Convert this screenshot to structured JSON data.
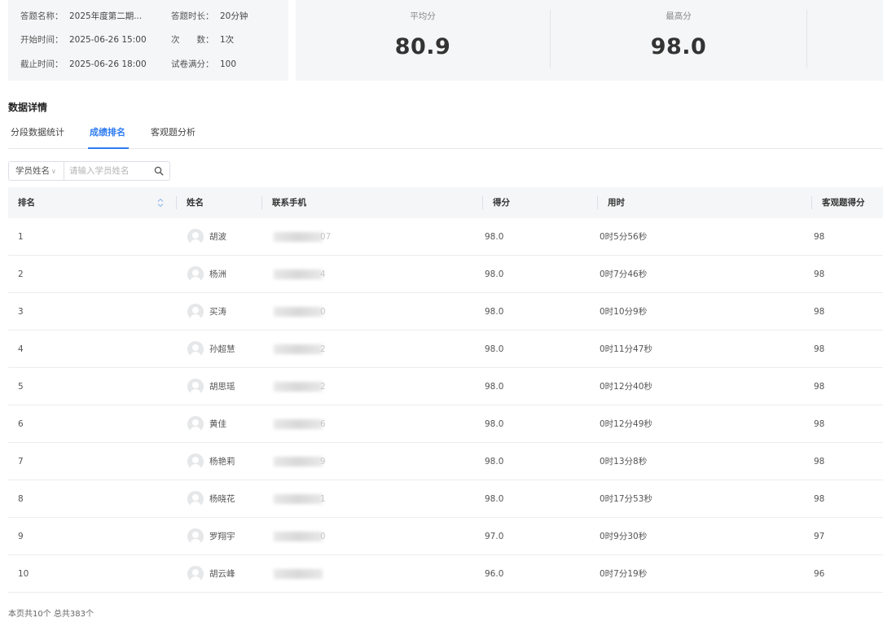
{
  "exam_info": {
    "name_label": "答题名称：",
    "name_value": "2025年度第二期...",
    "duration_label": "答题时长：",
    "duration_value": "20分钟",
    "start_label": "开始时间：",
    "start_value": "2025-06-26 15:00",
    "attempts_label": "次　　数：",
    "attempts_value": "1次",
    "end_label": "截止时间：",
    "end_value": "2025-06-26 18:00",
    "full_score_label": "试卷满分：",
    "full_score_value": "100"
  },
  "stats": {
    "avg_label": "平均分",
    "avg_value": "80.9",
    "max_label": "最高分",
    "max_value": "98.0"
  },
  "section_title": "数据详情",
  "tabs": [
    {
      "label": "分段数据统计",
      "active": false
    },
    {
      "label": "成绩排名",
      "active": true
    },
    {
      "label": "客观题分析",
      "active": false
    }
  ],
  "search": {
    "select_value": "学员姓名",
    "placeholder": "请输入学员姓名"
  },
  "table": {
    "headers": {
      "rank": "排名",
      "name": "姓名",
      "phone": "联系手机",
      "score": "得分",
      "time": "用时",
      "objective": "客观题得分"
    },
    "rows": [
      {
        "rank": "1",
        "name": "胡波",
        "phone_tail": "07",
        "score": "98.0",
        "time": "0时5分56秒",
        "objective": "98"
      },
      {
        "rank": "2",
        "name": "杨洲",
        "phone_tail": "4",
        "score": "98.0",
        "time": "0时7分46秒",
        "objective": "98"
      },
      {
        "rank": "3",
        "name": "买涛",
        "phone_tail": "0",
        "score": "98.0",
        "time": "0时10分9秒",
        "objective": "98"
      },
      {
        "rank": "4",
        "name": "孙超慧",
        "phone_tail": "2",
        "score": "98.0",
        "time": "0时11分47秒",
        "objective": "98"
      },
      {
        "rank": "5",
        "name": "胡思瑶",
        "phone_tail": "2",
        "score": "98.0",
        "time": "0时12分40秒",
        "objective": "98"
      },
      {
        "rank": "6",
        "name": "黄佳",
        "phone_tail": "6",
        "score": "98.0",
        "time": "0时12分49秒",
        "objective": "98"
      },
      {
        "rank": "7",
        "name": "杨艳莉",
        "phone_tail": "9",
        "score": "98.0",
        "time": "0时13分8秒",
        "objective": "98"
      },
      {
        "rank": "8",
        "name": "杨晓花",
        "phone_tail": "1",
        "score": "98.0",
        "time": "0时17分53秒",
        "objective": "98"
      },
      {
        "rank": "9",
        "name": "罗翔宇",
        "phone_tail": "0",
        "score": "97.0",
        "time": "0时9分30秒",
        "objective": "97"
      },
      {
        "rank": "10",
        "name": "胡云峰",
        "phone_tail": "",
        "score": "96.0",
        "time": "0时7分19秒",
        "objective": "96"
      }
    ]
  },
  "footer": "本页共10个 总共383个",
  "colors": {
    "accent": "#2d7bf0",
    "card_bg": "#f5f6f7",
    "header_bg": "#f5f6f7"
  }
}
